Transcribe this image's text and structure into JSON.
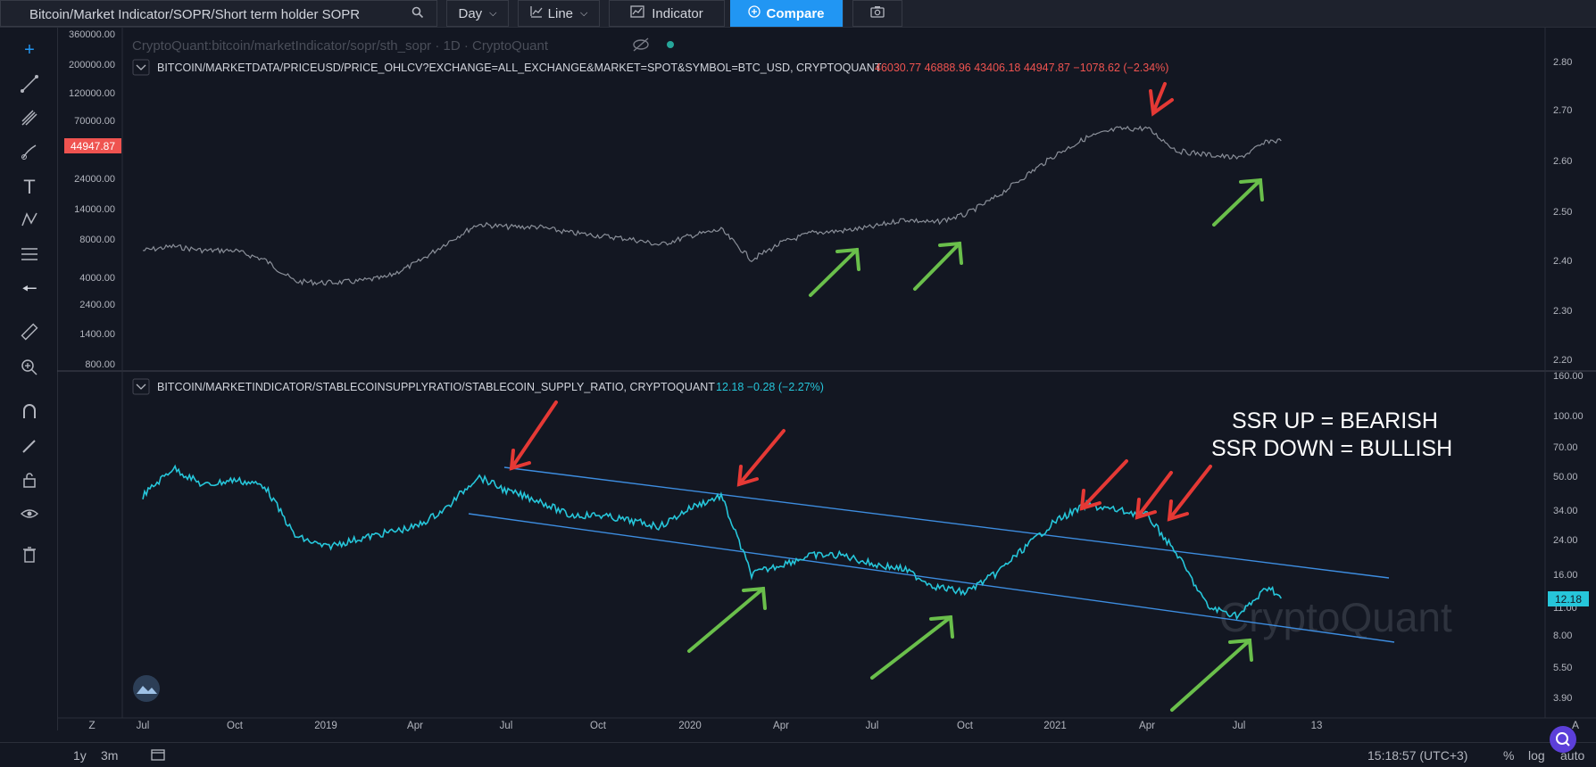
{
  "toolbar": {
    "search_value": "Bitcoin/Market Indicator/SOPR/Short term holder SOPR",
    "interval_label": "Day",
    "chart_style_label": "Line",
    "indicator_label": "Indicator",
    "compare_label": "Compare"
  },
  "pane1": {
    "watermark_title": "CryptoQuant:bitcoin/marketIndicator/sopr/sth_sopr · 1D · CryptoQuant",
    "legend_symbol": "BITCOIN/MARKETDATA/PRICEUSD/PRICE_OHLCV?EXCHANGE=ALL_EXCHANGE&MARKET=SPOT&SYMBOL=BTC_USD, CRYPTOQUANT",
    "legend_values": "46030.77  46888.96  43406.18  44947.87  −1078.62 (−2.34%)",
    "price_badge": "44947.87",
    "left_ticks": [
      "360000.00",
      "200000.00",
      "120000.00",
      "70000.00",
      "40000.00",
      "24000.00",
      "14000.00",
      "8000.00",
      "4000.00",
      "2400.00",
      "1400.00",
      "800.00"
    ],
    "right_ticks": [
      "2.80",
      "2.70",
      "2.60",
      "2.50",
      "2.40",
      "2.30",
      "2.20"
    ]
  },
  "pane2": {
    "legend_symbol": "BITCOIN/MARKETINDICATOR/STABLECOINSUPPLYRATIO/STABLECOIN_SUPPLY_RATIO, CRYPTOQUANT",
    "legend_values": "12.18  −0.28 (−2.27%)",
    "right_ticks": [
      "160.00",
      "100.00",
      "70.00",
      "50.00",
      "34.00",
      "24.00",
      "16.00",
      "11.00",
      "8.00",
      "5.50",
      "3.90"
    ],
    "value_badge": "12.18",
    "annotation_line1": "SSR UP = BEARISH",
    "annotation_line2": "SSR DOWN = BULLISH",
    "watermark": "CryptoQuant"
  },
  "x_axis_labels": [
    "Jul",
    "Oct",
    "2019",
    "Apr",
    "Jul",
    "Oct",
    "2020",
    "Apr",
    "Jul",
    "Oct",
    "2021",
    "Apr",
    "Jul",
    "13"
  ],
  "bottom": {
    "range_1y": "1y",
    "range_3m": "3m",
    "clock": "15:18:57 (UTC+3)",
    "pct": "%",
    "log": "log",
    "auto": "auto",
    "axis_corner": "Z",
    "axis_corner_right": "A"
  },
  "colors": {
    "background": "#131722",
    "price_line": "#8a8f99",
    "ssr_line": "#26c6da",
    "channel": "#3d8de0",
    "red_arrow": "#e53935",
    "green_arrow": "#6abf4b",
    "badge_red": "#ef5350"
  },
  "chart_data": [
    {
      "type": "line",
      "title": "",
      "series": [
        {
          "name": "BITCOIN/MARKETDATA/PRICEUSD/PRICE_OHLCV BTC_USD",
          "values": [
            {
              "x": "2018-07",
              "y": 6500
            },
            {
              "x": "2018-08",
              "y": 7000
            },
            {
              "x": "2018-09",
              "y": 6500
            },
            {
              "x": "2018-10",
              "y": 6500
            },
            {
              "x": "2018-11",
              "y": 5500
            },
            {
              "x": "2018-12",
              "y": 3700
            },
            {
              "x": "2019-01",
              "y": 3600
            },
            {
              "x": "2019-02",
              "y": 3700
            },
            {
              "x": "2019-03",
              "y": 4000
            },
            {
              "x": "2019-04",
              "y": 5200
            },
            {
              "x": "2019-05",
              "y": 7500
            },
            {
              "x": "2019-06",
              "y": 10500
            },
            {
              "x": "2019-07",
              "y": 10000
            },
            {
              "x": "2019-08",
              "y": 10000
            },
            {
              "x": "2019-09",
              "y": 9000
            },
            {
              "x": "2019-10",
              "y": 8500
            },
            {
              "x": "2019-11",
              "y": 8000
            },
            {
              "x": "2019-12",
              "y": 7200
            },
            {
              "x": "2020-01",
              "y": 8500
            },
            {
              "x": "2020-02",
              "y": 9500
            },
            {
              "x": "2020-03",
              "y": 5500
            },
            {
              "x": "2020-04",
              "y": 7500
            },
            {
              "x": "2020-05",
              "y": 9000
            },
            {
              "x": "2020-06",
              "y": 9300
            },
            {
              "x": "2020-07",
              "y": 10000
            },
            {
              "x": "2020-08",
              "y": 11500
            },
            {
              "x": "2020-09",
              "y": 10800
            },
            {
              "x": "2020-10",
              "y": 12500
            },
            {
              "x": "2020-11",
              "y": 17000
            },
            {
              "x": "2020-12",
              "y": 25000
            },
            {
              "x": "2021-01",
              "y": 35000
            },
            {
              "x": "2021-02",
              "y": 48000
            },
            {
              "x": "2021-03",
              "y": 58000
            },
            {
              "x": "2021-04",
              "y": 59000
            },
            {
              "x": "2021-05",
              "y": 37000
            },
            {
              "x": "2021-06",
              "y": 35000
            },
            {
              "x": "2021-07",
              "y": 33000
            },
            {
              "x": "2021-08",
              "y": 45000
            },
            {
              "x": "2021-08-13",
              "y": 44947.87
            }
          ]
        }
      ],
      "y_scale": "log",
      "ylim": [
        800,
        360000
      ],
      "y_ticks": [
        360000,
        200000,
        120000,
        70000,
        40000,
        24000,
        14000,
        8000,
        4000,
        2400,
        1400,
        800
      ],
      "right_ylim": [
        2.2,
        2.8
      ],
      "grid": false
    },
    {
      "type": "line",
      "title": "",
      "series": [
        {
          "name": "BITCOIN/MARKETINDICATOR/STABLECOINSUPPLYRATIO/STABLECOIN_SUPPLY_RATIO",
          "values": [
            {
              "x": "2018-07",
              "y": 40
            },
            {
              "x": "2018-08",
              "y": 55
            },
            {
              "x": "2018-09",
              "y": 45
            },
            {
              "x": "2018-10",
              "y": 48
            },
            {
              "x": "2018-11",
              "y": 45
            },
            {
              "x": "2018-12",
              "y": 25
            },
            {
              "x": "2019-01",
              "y": 22
            },
            {
              "x": "2019-02",
              "y": 24
            },
            {
              "x": "2019-03",
              "y": 26
            },
            {
              "x": "2019-04",
              "y": 28
            },
            {
              "x": "2019-05",
              "y": 35
            },
            {
              "x": "2019-06",
              "y": 50
            },
            {
              "x": "2019-07",
              "y": 42
            },
            {
              "x": "2019-08",
              "y": 38
            },
            {
              "x": "2019-09",
              "y": 32
            },
            {
              "x": "2019-10",
              "y": 32
            },
            {
              "x": "2019-11",
              "y": 30
            },
            {
              "x": "2019-12",
              "y": 28
            },
            {
              "x": "2020-01",
              "y": 35
            },
            {
              "x": "2020-02",
              "y": 40
            },
            {
              "x": "2020-03",
              "y": 16
            },
            {
              "x": "2020-04",
              "y": 18
            },
            {
              "x": "2020-05",
              "y": 20
            },
            {
              "x": "2020-06",
              "y": 20
            },
            {
              "x": "2020-07",
              "y": 18
            },
            {
              "x": "2020-08",
              "y": 17
            },
            {
              "x": "2020-09",
              "y": 14
            },
            {
              "x": "2020-10",
              "y": 13
            },
            {
              "x": "2020-11",
              "y": 16
            },
            {
              "x": "2020-12",
              "y": 22
            },
            {
              "x": "2021-01",
              "y": 30
            },
            {
              "x": "2021-02",
              "y": 36
            },
            {
              "x": "2021-03",
              "y": 34
            },
            {
              "x": "2021-04",
              "y": 32
            },
            {
              "x": "2021-05",
              "y": 20
            },
            {
              "x": "2021-06",
              "y": 11
            },
            {
              "x": "2021-07",
              "y": 10
            },
            {
              "x": "2021-08",
              "y": 14
            },
            {
              "x": "2021-08-13",
              "y": 12.18
            }
          ]
        }
      ],
      "y_scale": "log",
      "ylim": [
        3.9,
        160
      ],
      "y_ticks": [
        160,
        100,
        70,
        50,
        34,
        24,
        16,
        11,
        8,
        5.5,
        3.9
      ],
      "grid": false
    }
  ]
}
